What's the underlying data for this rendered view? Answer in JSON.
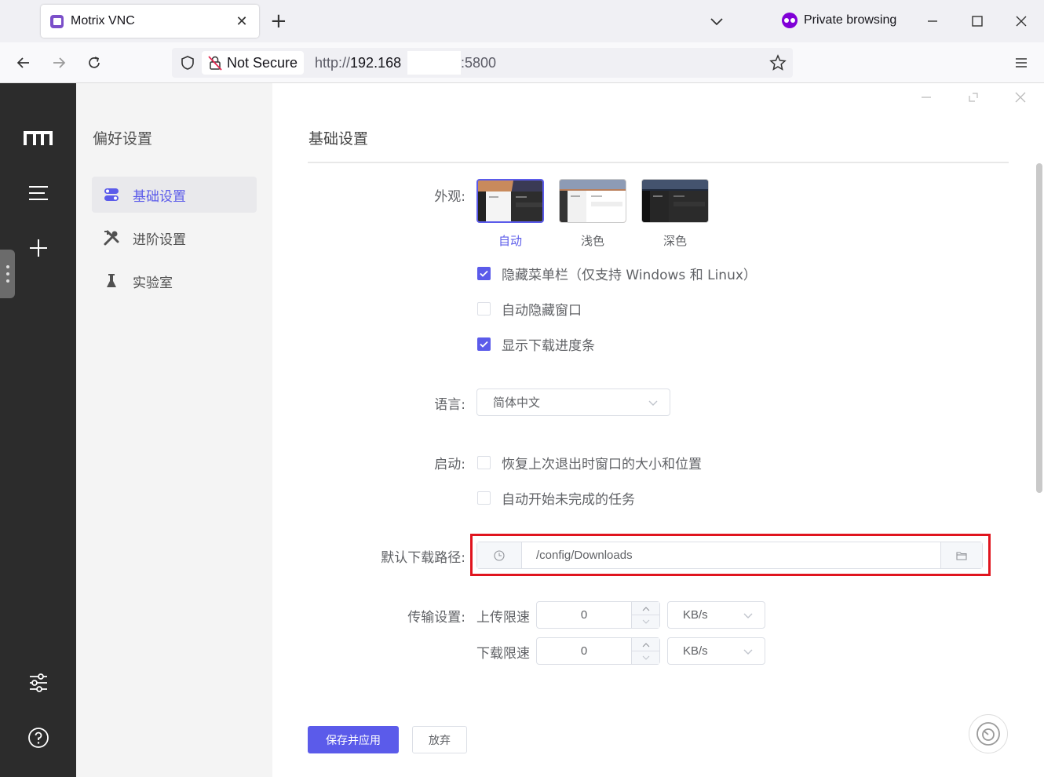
{
  "browser": {
    "tab_title": "Motrix VNC",
    "tab_close": "✕",
    "new_tab": "+",
    "private_label": "Private browsing",
    "not_secure": "Not Secure",
    "url_scheme": "http://",
    "url_host": "192.168",
    "url_port": ":5800"
  },
  "subnav": {
    "title": "偏好设置",
    "items": [
      {
        "label": "基础设置",
        "icon": "toggle-icon",
        "active": true
      },
      {
        "label": "进阶设置",
        "icon": "tools-icon",
        "active": false
      },
      {
        "label": "实验室",
        "icon": "flask-icon",
        "active": false
      }
    ]
  },
  "main": {
    "title": "基础设置",
    "appearance": {
      "label": "外观:",
      "options": [
        "自动",
        "浅色",
        "深色"
      ],
      "selected": "自动"
    },
    "checkboxes": [
      {
        "label": "隐藏菜单栏（仅支持 Windows 和 Linux）",
        "checked": true
      },
      {
        "label": "自动隐藏窗口",
        "checked": false
      },
      {
        "label": "显示下载进度条",
        "checked": true
      }
    ],
    "language": {
      "label": "语言:",
      "value": "简体中文"
    },
    "startup": {
      "label": "启动:",
      "options": [
        {
          "label": "恢复上次退出时窗口的大小和位置",
          "checked": false
        },
        {
          "label": "自动开始未完成的任务",
          "checked": false
        }
      ]
    },
    "download_path": {
      "label": "默认下载路径:",
      "value": "/config/Downloads"
    },
    "transfer": {
      "label": "传输设置:",
      "upload_label": "上传限速",
      "upload_value": "0",
      "upload_unit": "KB/s",
      "download_label": "下载限速",
      "download_value": "0",
      "download_unit": "KB/s"
    },
    "save_button": "保存并应用",
    "discard_button": "放弃"
  },
  "colors": {
    "accent": "#5b5bea",
    "sidebar": "#2c2c2c",
    "highlight": "#e0141e"
  }
}
